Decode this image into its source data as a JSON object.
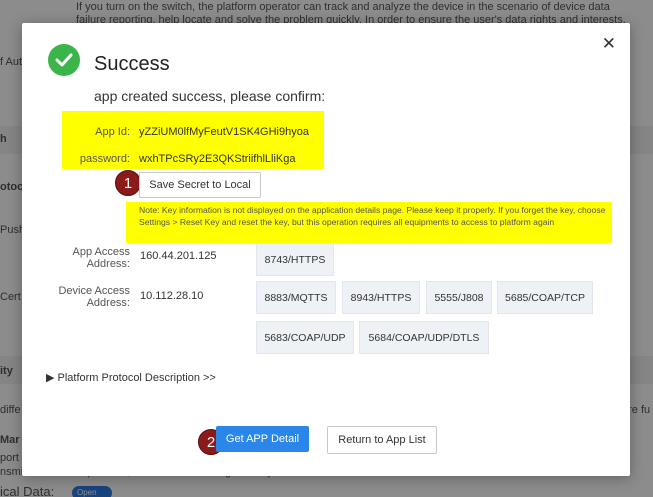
{
  "background": {
    "lines": [
      "If you turn on the switch, the platform operator can track and analyze the device in the scenario of device data",
      "failure reporting, help locate and solve the problem quickly. In order to ensure the user's data rights and interests,"
    ],
    "fragments": {
      "aut": "f Auth",
      "h": "h",
      "otoc": "otoc",
      "push": "Push",
      "cert": "Cert",
      "ity": "ity",
      "diffe": "diffe",
      "re_fu": "ore fu",
      "mar": "Mar",
      "port": "port",
      "nsmit": "nsmit data on the platform, switch on the storage history data switch",
      "historical_data": "ical Data:",
      "toggle": "Open"
    }
  },
  "modal": {
    "title": "Success",
    "subtitle": "app created success, please confirm:",
    "close_icon": "close-icon",
    "app_id_label": "App Id:",
    "app_id_value": "yZZiUM0lfMyFeutV1SK4GHi9hyoa",
    "password_label": "password:",
    "password_value": "wxhTPcSRy2E3QKStriifhlLliKga",
    "save_secret_label": "Save Secret to Local",
    "note": "Note: Key information is not displayed on the application details page. Please keep it properly. If you forget the key, choose Settings > Reset Key and reset the key, but this operation requires all equipments to access to platform again",
    "app_access_label": "App Access Address:",
    "app_access_ip": "160.44.201.125",
    "app_access_ports": [
      "8743/HTTPS"
    ],
    "device_access_label": "Device Access Address:",
    "device_access_ip": "10.112.28.10",
    "device_ports_row1": [
      "8883/MQTTS",
      "8943/HTTPS",
      "5555/J808",
      "5685/COAP/TCP"
    ],
    "device_ports_row2": [
      "5683/COAP/UDP",
      "5684/COAP/UDP/DTLS"
    ],
    "protocol_desc": "▶ Platform Protocol Description >>",
    "get_detail_label": "Get APP Detail",
    "return_label": "Return to App List"
  },
  "annotations": {
    "badge1": "1",
    "badge2": "2",
    "highlight_color": "#ffff00",
    "badge_color": "#8b1a1a"
  },
  "colors": {
    "primary": "#2a86e8",
    "success": "#3bb54a"
  }
}
